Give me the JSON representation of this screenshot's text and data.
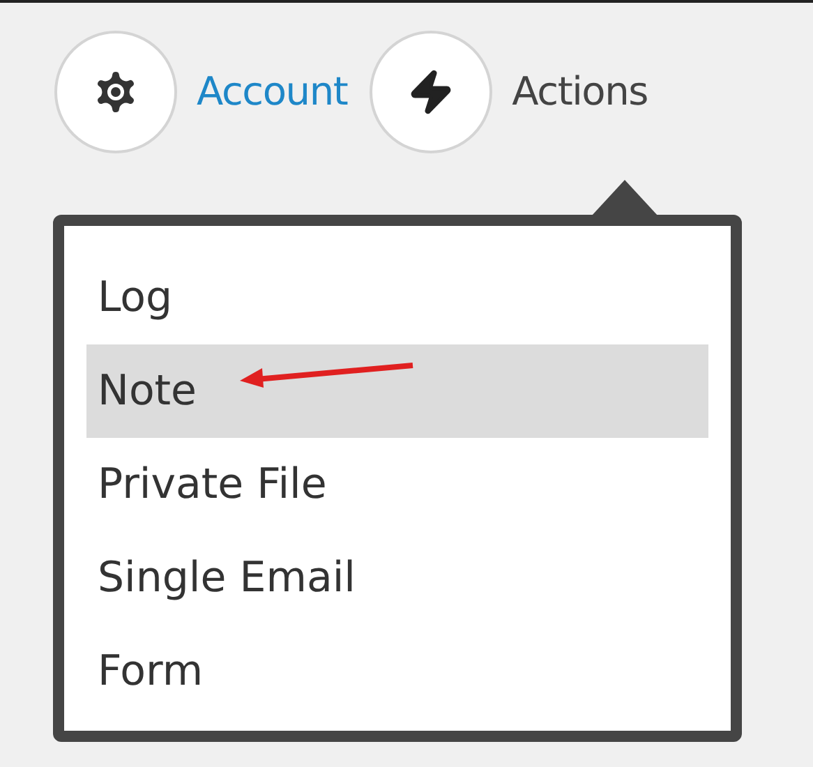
{
  "nav": [
    {
      "label": "Account",
      "kind": "gear",
      "selected": false
    },
    {
      "label": "Actions",
      "kind": "bolt",
      "selected": true
    }
  ],
  "menu": [
    {
      "label": "Log",
      "selected": false
    },
    {
      "label": "Note",
      "selected": true
    },
    {
      "label": "Private File",
      "selected": false
    },
    {
      "label": "Single Email",
      "selected": false
    },
    {
      "label": "Form",
      "selected": false
    }
  ]
}
